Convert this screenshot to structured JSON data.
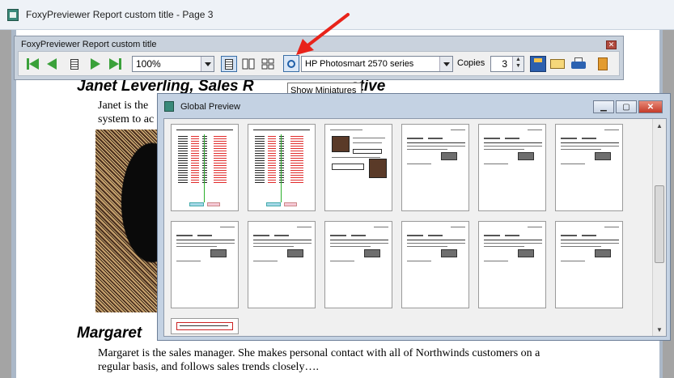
{
  "window": {
    "title": "FoxyPreviewer Report custom title - Page 3"
  },
  "toolbar": {
    "title": "FoxyPreviewer Report custom title",
    "close_glyph": "✕",
    "zoom_value": "100%",
    "printer_value": "HP Photosmart 2570 series",
    "copies_label": "Copies",
    "copies_value": "3",
    "spin_up": "▲",
    "spin_down": "▼"
  },
  "tooltip": {
    "text": "Show Miniatures"
  },
  "global_preview": {
    "title": "Global Preview",
    "min_glyph": "▁",
    "max_glyph": "▢",
    "close_glyph": "✕",
    "scroll_up": "▲",
    "scroll_down": "▼",
    "thumbnail_count": 13
  },
  "document": {
    "heading_1": "Janet Leverling,   Sales R",
    "heading_1_tail": "ative",
    "text_1a": "Janet is the",
    "text_1b": "system to ac",
    "heading_2": "Margaret",
    "text_2a": "Margaret is the sales manager.  She makes personal contact with all of Northwinds customers on a",
    "text_2b": "regular basis, and follows sales trends closely…."
  },
  "colors": {
    "arrow": "#e8231a",
    "title_bar": "#eef2f7",
    "accent": "#3a6ea5"
  }
}
